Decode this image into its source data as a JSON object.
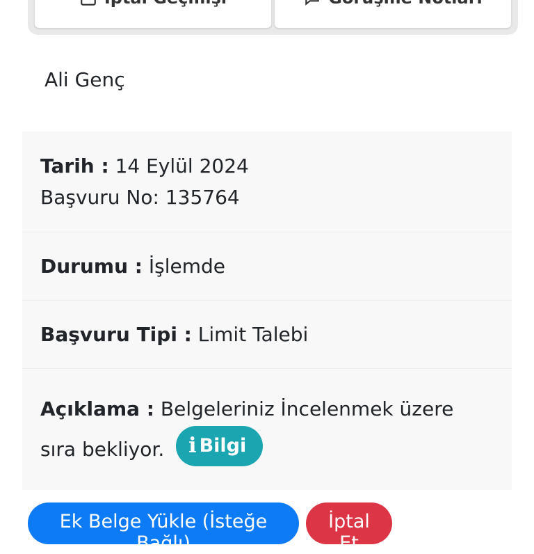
{
  "top_tabs": {
    "tab1": {
      "icon": "calendar-icon",
      "label": "İptal Geçmişi"
    },
    "tab2": {
      "icon": "chat-icon",
      "label": "Görüşme Notları"
    }
  },
  "customer": {
    "name": "Ali Genç"
  },
  "application": {
    "date_label": "Tarih :",
    "date_value": "14 Eylül 2024",
    "number_label": "Başvuru No:",
    "number_value": "135764",
    "status_label": "Durumu :",
    "status_value": "İşlemde",
    "type_label": "Başvuru Tipi :",
    "type_value": "Limit Talebi",
    "desc_label": "Açıklama :",
    "desc_value": "Belgeleriniz İncelenmek üzere sıra bekliyor.",
    "info_badge": {
      "icon": "info-icon",
      "label": "Bilgi",
      "color": "#1aa5b0"
    }
  },
  "actions": {
    "upload_label": "Ek Belge Yükle (İsteğe Bağlı)",
    "upload_color": "#0d7bf5",
    "cancel_label": "İptal Et",
    "cancel_color": "#dc3545"
  }
}
